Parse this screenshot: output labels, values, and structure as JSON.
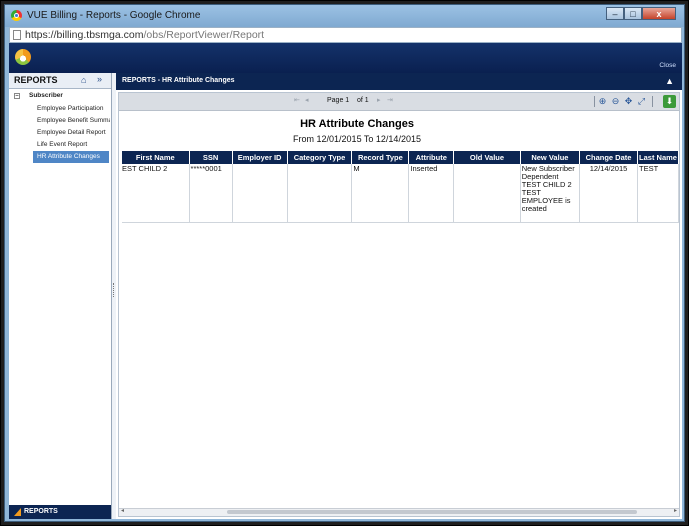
{
  "window": {
    "title": "VUE Billing - Reports - Google Chrome",
    "minimize": "–",
    "maximize": "□",
    "close": "x"
  },
  "address": {
    "host": "https://billing.tbsmga.com",
    "path": "/obs/ReportViewer/Report"
  },
  "app": {
    "close_label": "Close"
  },
  "sidebar": {
    "header": "REPORTS",
    "root_label": "Subscriber",
    "root_toggle": "–",
    "items": [
      {
        "label": "Employee Participation"
      },
      {
        "label": "Employee Benefit Summary"
      },
      {
        "label": "Employee Detail Report"
      },
      {
        "label": "Life Event Report"
      },
      {
        "label": "HR Attribute Changes"
      }
    ],
    "footer": "REPORTS"
  },
  "main": {
    "header": "REPORTS - HR Attribute Changes"
  },
  "toolbar": {
    "page_label": "Page 1",
    "of_label": "of 1"
  },
  "report": {
    "title": "HR Attribute Changes",
    "subtitle": "From 12/01/2015 To 12/14/2015",
    "columns": [
      "First Name",
      "SSN",
      "Employer ID",
      "Category Type",
      "Record Type",
      "Attribute",
      "Old Value",
      "New Value",
      "Change Date",
      "Last Name"
    ],
    "rows": [
      [
        "EST CHILD 2",
        "*****0001",
        "",
        "",
        "M",
        "Inserted",
        "",
        "New Subscriber Dependent TEST CHILD 2 TEST EMPLOYEE is created",
        "12/14/2015",
        "TEST"
      ]
    ]
  },
  "colors": {
    "navy": "#0c2552",
    "selected": "#4f86c6",
    "accent": "#f29b1d",
    "download": "#3c9a3a"
  }
}
